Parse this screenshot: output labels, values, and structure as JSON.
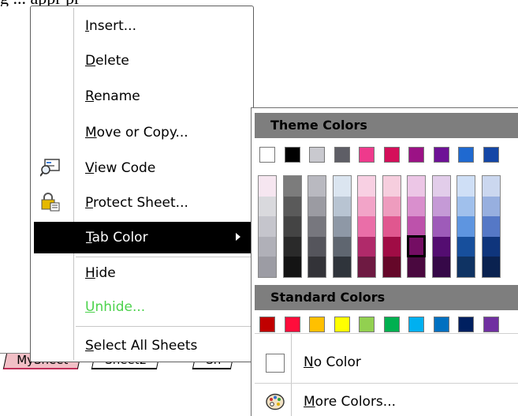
{
  "top_fragment_text": "g ... appr pr",
  "sheet_tabs": [
    {
      "label": "MySheet"
    },
    {
      "label": "Sheet2"
    },
    {
      "label": "Sh"
    }
  ],
  "context_menu": {
    "items": [
      {
        "pre": "",
        "ul": "I",
        "post": "nsert..."
      },
      {
        "pre": "",
        "ul": "D",
        "post": "elete"
      },
      {
        "pre": "",
        "ul": "R",
        "post": "ename"
      },
      {
        "pre": "",
        "ul": "M",
        "post": "ove or Copy..."
      },
      {
        "pre": "",
        "ul": "V",
        "post": "iew Code",
        "icon": "view-code-icon"
      },
      {
        "pre": "",
        "ul": "P",
        "post": "rotect Sheet...",
        "icon": "protect-sheet-icon"
      },
      {
        "pre": "",
        "ul": "T",
        "post": "ab Color",
        "state": "highlighted",
        "submenu": true
      },
      {
        "pre": "",
        "ul": "H",
        "post": "ide"
      },
      {
        "pre": "",
        "ul": "U",
        "post": "nhide...",
        "state": "disabled"
      },
      {
        "pre": "",
        "ul": "S",
        "post": "elect All Sheets"
      }
    ],
    "highlight_color": "#000000",
    "disabled_color": "#4cd24c"
  },
  "color_menu": {
    "theme_header": "Theme Colors",
    "standard_header": "Standard Colors",
    "theme_top_colors": [
      "#ffffff",
      "#000000",
      "#c9c9cf",
      "#5e5e66",
      "#ee3a8c",
      "#d40f5a",
      "#9b1285",
      "#6e1196",
      "#1f69d0",
      "#1446a6"
    ],
    "theme_shades": [
      [
        "#f6e6f0",
        "#d9d9dd",
        "#c5c5cc",
        "#b0b0b8",
        "#9c9ca4"
      ],
      [
        "#7c7c7c",
        "#5a5a5a",
        "#444444",
        "#2a2a2a",
        "#141414"
      ],
      [
        "#b9b9c0",
        "#9b9ba2",
        "#77777e",
        "#55555c",
        "#333338"
      ],
      [
        "#dbe5f0",
        "#b8c4d2",
        "#8e98a6",
        "#5f6670",
        "#2f343b"
      ],
      [
        "#f8d0e3",
        "#f2a4c8",
        "#ea6ea8",
        "#b02a6a",
        "#6e1a42"
      ],
      [
        "#f6cede",
        "#ee9cbe",
        "#e0578f",
        "#a00c45",
        "#650729"
      ],
      [
        "#ecc6e6",
        "#d98fcd",
        "#bd52ab",
        "#740d63",
        "#4a083f"
      ],
      [
        "#e2cdea",
        "#c59ad6",
        "#9e5bb9",
        "#540d71",
        "#360848"
      ],
      [
        "#cfdff6",
        "#a0c0ec",
        "#5e95e0",
        "#174f9c",
        "#0f3363"
      ],
      [
        "#cbd7ef",
        "#97afdf",
        "#5578c6",
        "#0f357c",
        "#0a2250"
      ]
    ],
    "standard_colors": [
      "#c00000",
      "#ff0d3b",
      "#ffc000",
      "#ffff00",
      "#92d050",
      "#00b050",
      "#00b0f0",
      "#0070c0",
      "#002060",
      "#7030a0"
    ],
    "no_color": {
      "ul": "N",
      "post": "o Color"
    },
    "more_colors": {
      "ul": "M",
      "post": "ore Colors..."
    }
  }
}
